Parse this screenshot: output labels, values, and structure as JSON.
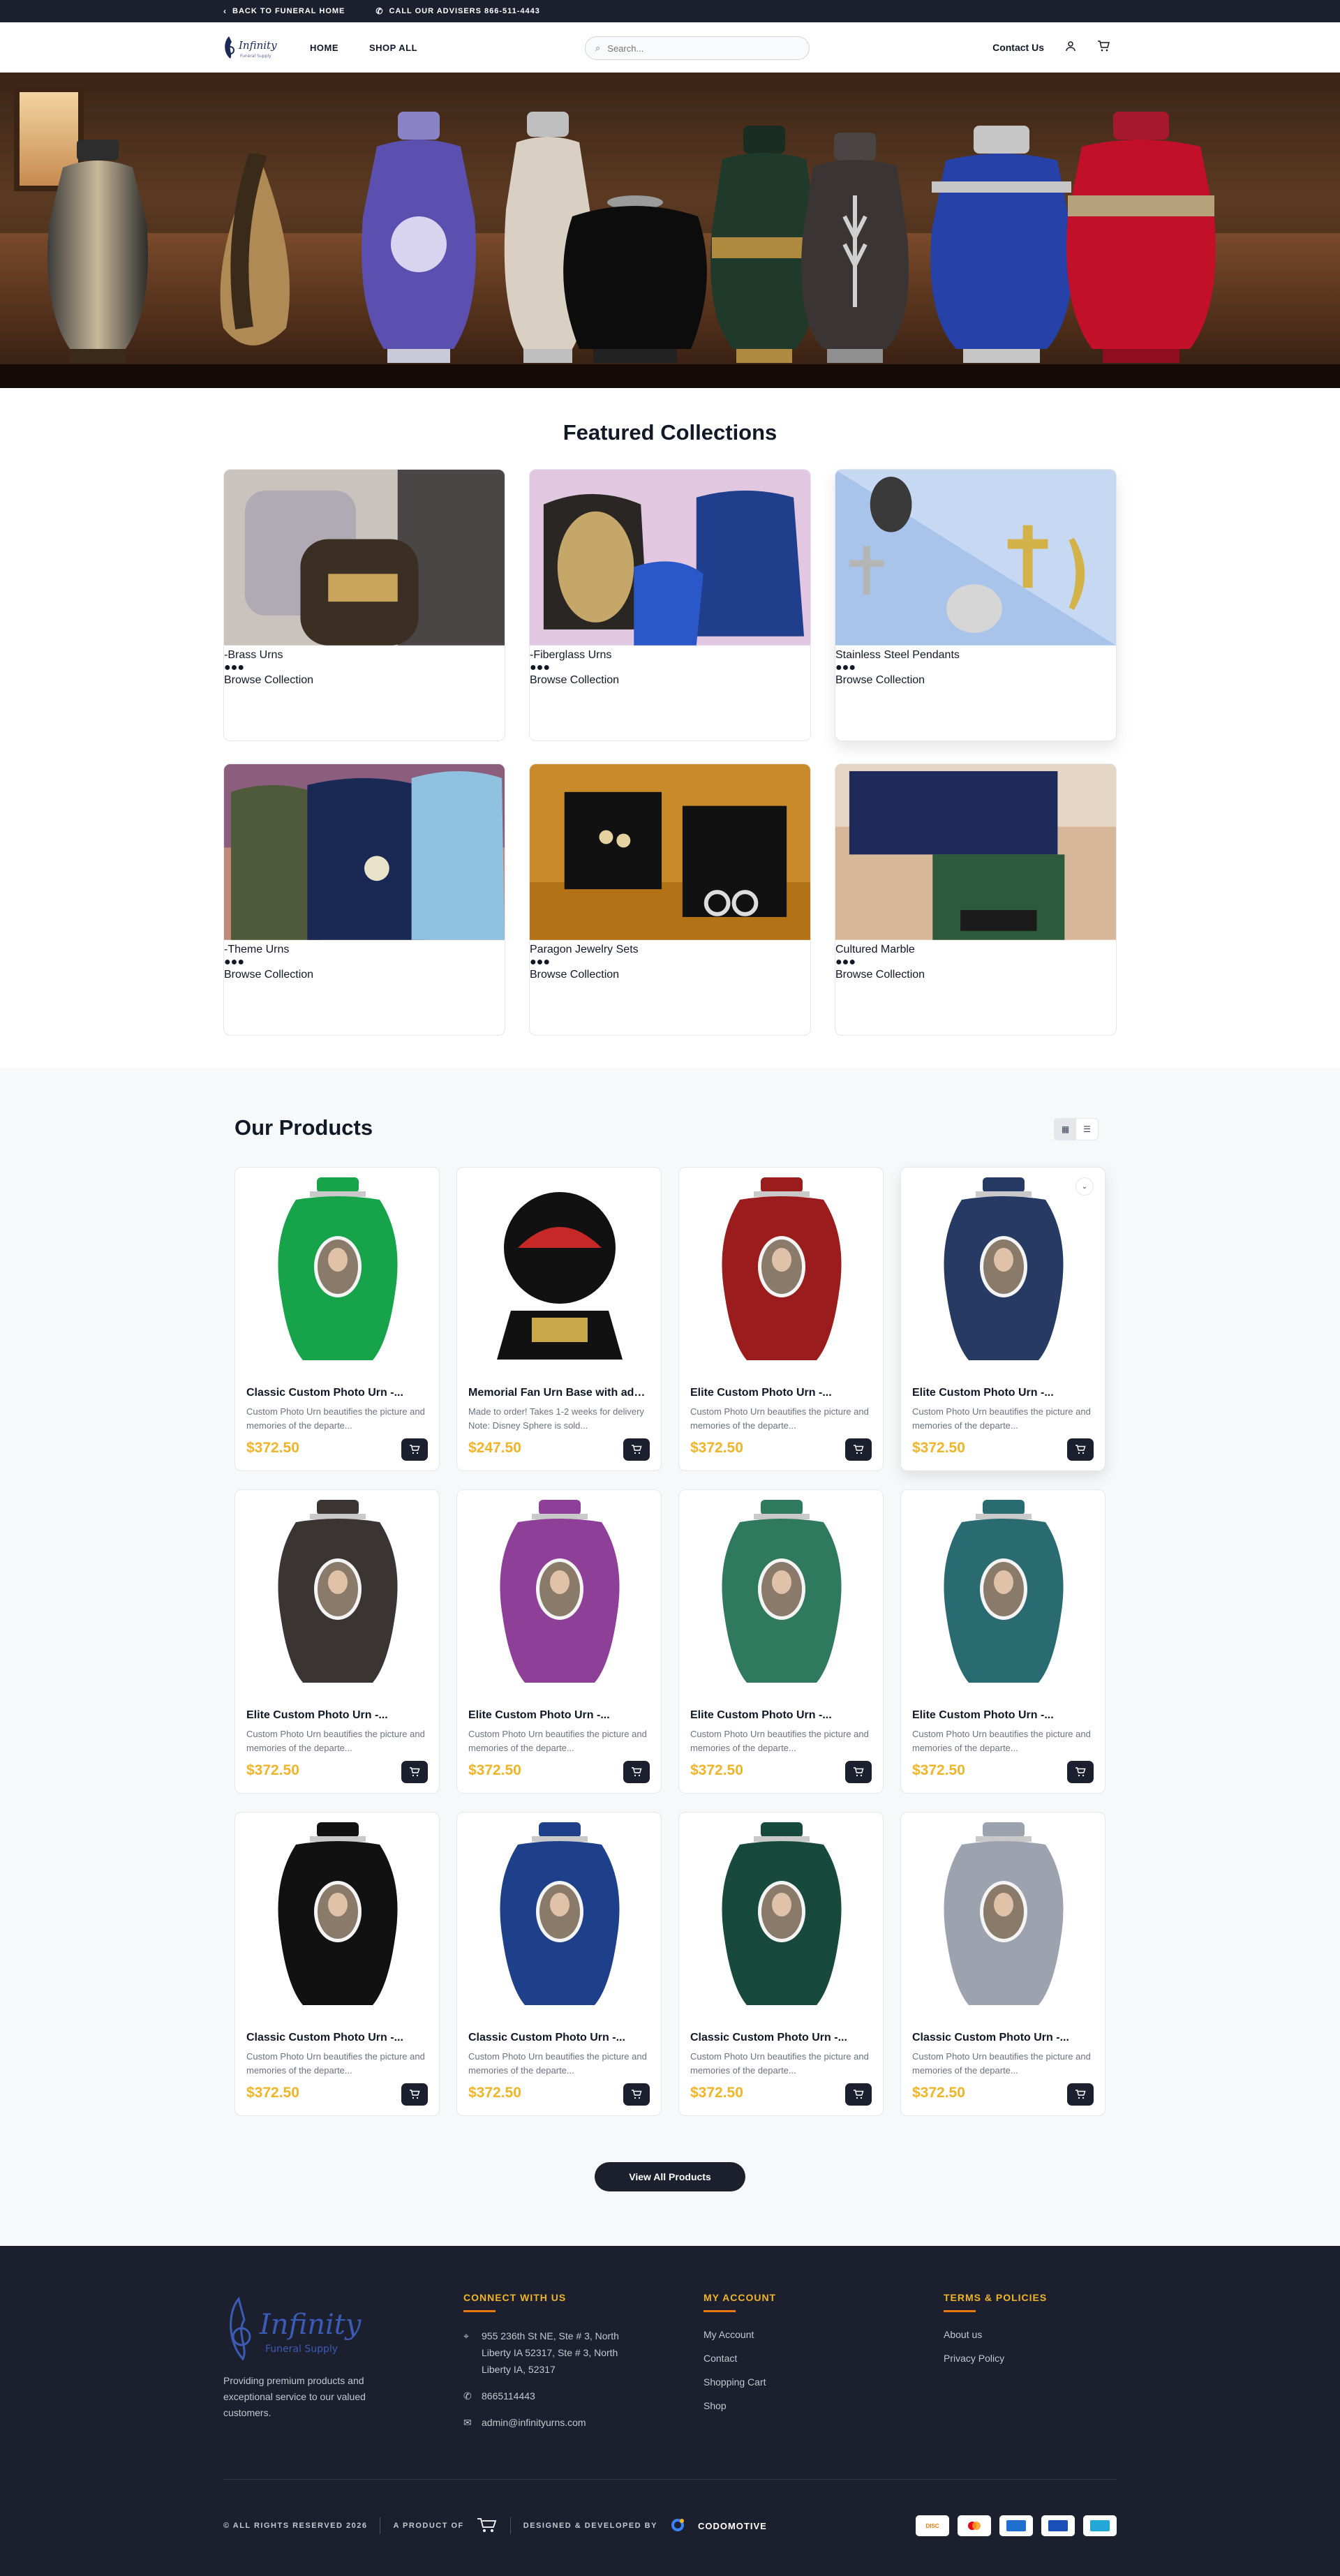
{
  "topbar": {
    "back_label": "BACK TO FUNERAL HOME",
    "call_label": "CALL OUR ADVISERS 866-511-4443"
  },
  "header": {
    "logo_text": "Infinity",
    "logo_sub": "Funeral Supply",
    "nav": [
      "HOME",
      "SHOP ALL"
    ],
    "search_placeholder": "Search...",
    "contact_label": "Contact Us"
  },
  "featured": {
    "title": "Featured Collections",
    "button_label": "Browse Collection",
    "items": [
      {
        "title": "-Brass Urns"
      },
      {
        "title": "-Fiberglass Urns"
      },
      {
        "title": "Stainless Steel Pendants"
      },
      {
        "title": "-Theme Urns"
      },
      {
        "title": "Paragon Jewelry Sets"
      },
      {
        "title": "Cultured Marble"
      }
    ]
  },
  "products": {
    "title": "Our Products",
    "view_all_label": "View All Products",
    "items": [
      {
        "name": "Classic Custom Photo Urn -...",
        "desc": "Custom Photo Urn beautifies the picture and memories of the departe...",
        "price": "$372.50",
        "color": "#16a34a"
      },
      {
        "name": "Memorial Fan Urn Base with add ...",
        "desc": "Made to order! Takes 1-2 weeks for delivery Note: Disney Sphere is sold...",
        "price": "$247.50",
        "color": "#111111"
      },
      {
        "name": "Elite Custom Photo Urn -...",
        "desc": "Custom Photo Urn beautifies the picture and memories of the departe...",
        "price": "$372.50",
        "color": "#9b1c1c"
      },
      {
        "name": "Elite Custom Photo Urn -...",
        "desc": "Custom Photo Urn beautifies the picture and memories of the departe...",
        "price": "$372.50",
        "color": "#263a63"
      },
      {
        "name": "Elite Custom Photo Urn -...",
        "desc": "Custom Photo Urn beautifies the picture and memories of the departe...",
        "price": "$372.50",
        "color": "#3a3533"
      },
      {
        "name": "Elite Custom Photo Urn -...",
        "desc": "Custom Photo Urn beautifies the picture and memories of the departe...",
        "price": "$372.50",
        "color": "#8e3f98"
      },
      {
        "name": "Elite Custom Photo Urn -...",
        "desc": "Custom Photo Urn beautifies the picture and memories of the departe...",
        "price": "$372.50",
        "color": "#2f7a5e"
      },
      {
        "name": "Elite Custom Photo Urn -...",
        "desc": "Custom Photo Urn beautifies the picture and memories of the departe...",
        "price": "$372.50",
        "color": "#2a6b72"
      },
      {
        "name": "Classic Custom Photo Urn -...",
        "desc": "Custom Photo Urn beautifies the picture and memories of the departe...",
        "price": "$372.50",
        "color": "#111111"
      },
      {
        "name": "Classic Custom Photo Urn -...",
        "desc": "Custom Photo Urn beautifies the picture and memories of the departe...",
        "price": "$372.50",
        "color": "#1e3f8a"
      },
      {
        "name": "Classic Custom Photo Urn -...",
        "desc": "Custom Photo Urn beautifies the picture and memories of the departe...",
        "price": "$372.50",
        "color": "#174a3c"
      },
      {
        "name": "Classic Custom Photo Urn -...",
        "desc": "Custom Photo Urn beautifies the picture and memories of the departe...",
        "price": "$372.50",
        "color": "#9ca3af"
      }
    ]
  },
  "footer": {
    "logo_text": "Infinity",
    "logo_sub": "Funeral Supply",
    "tagline": "Providing premium products and exceptional service to our valued customers.",
    "connect": {
      "title": "CONNECT WITH US",
      "address": "955 236th St NE, Ste # 3, North Liberty IA 52317, Ste # 3, North Liberty IA, 52317",
      "phone": "8665114443",
      "email": "admin@infinityurns.com"
    },
    "account": {
      "title": "MY ACCOUNT",
      "links": [
        "My Account",
        "Contact",
        "Shopping Cart",
        "Shop"
      ]
    },
    "terms": {
      "title": "TERMS & POLICIES",
      "links": [
        "About us",
        "Privacy Policy"
      ]
    },
    "copyright": "© ALL RIGHTS RESERVED 2026",
    "product_of": "A PRODUCT OF",
    "designed_by": "DESIGNED & DEVELOPED BY",
    "dev_brand": "CODOMOTIVE",
    "payments": [
      "discover-icon",
      "mastercard-icon",
      "amex-icon",
      "visa-icon",
      "card-icon"
    ]
  },
  "colors": {
    "dark": "#1b1f2e",
    "accent": "#f0b429",
    "orange": "#e8790f"
  }
}
